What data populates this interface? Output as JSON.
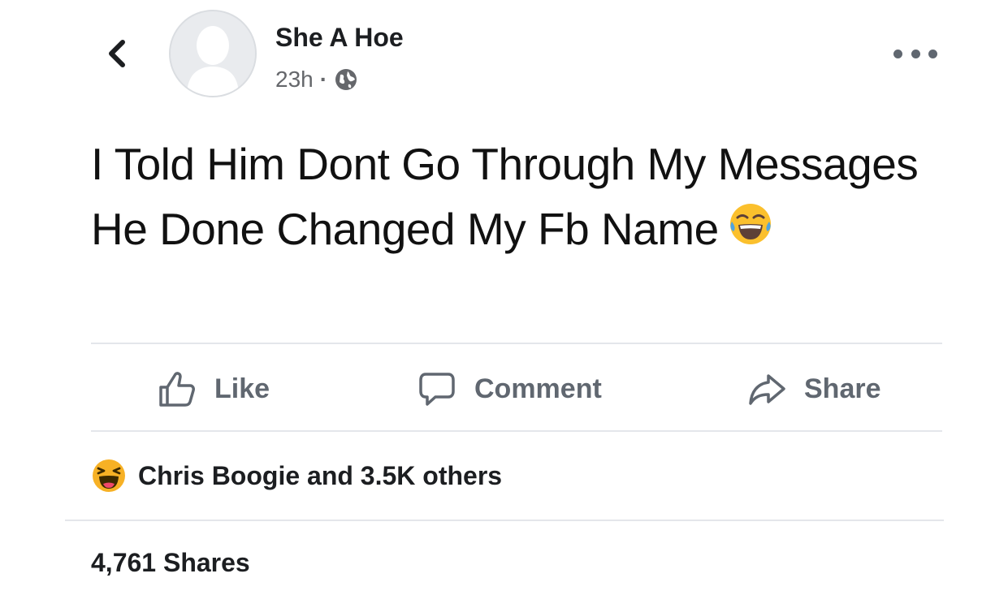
{
  "post": {
    "author": "She A Hoe",
    "time": "23h",
    "separator": "·",
    "privacy_icon": "globe-icon",
    "text": "I Told Him Dont Go Through My Messages He Done Changed My Fb Name",
    "emoji": "😂"
  },
  "actions": {
    "like_label": "Like",
    "comment_label": "Comment",
    "share_label": "Share"
  },
  "reactions": {
    "reaction_icon": "haha-reaction-icon",
    "summary": "Chris Boogie and 3.5K others"
  },
  "shares": {
    "label": "4,761 Shares"
  },
  "colors": {
    "muted": "#606770",
    "text": "#1c1e21",
    "divider": "#e4e6eb",
    "reaction_yellow": "#f7b125"
  }
}
